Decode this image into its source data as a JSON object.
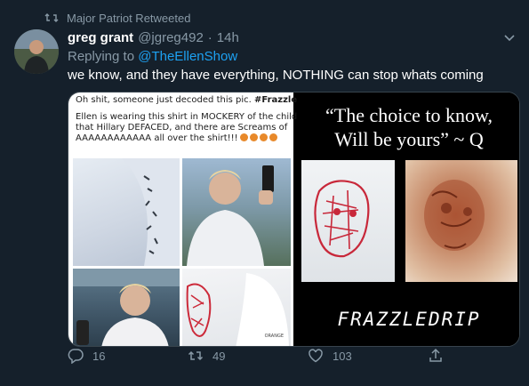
{
  "retweet_header": {
    "icon": "retweet-icon",
    "text": "Major Patriot Retweeted"
  },
  "tweet": {
    "author_name": "greg grant",
    "handle": "@jgreg492",
    "separator": "·",
    "time": "14h",
    "reply_prefix": "Replying to",
    "reply_to": "@TheEllenShow",
    "text": "we know, and they have everything, NOTHING can stop whats coming"
  },
  "media": {
    "left_panel": {
      "caption_prefix": "Oh shit, someone just decoded this pic.",
      "caption_tag": "#Frazzledrip",
      "body_lines": [
        "Ellen is wearing this shirt in MOCKERY of the child",
        "that Hillary DEFACED, and there are Screams of",
        "AAAAAAAAAAAA all over the shirt!!!"
      ],
      "shirt_text": "ORANGE"
    },
    "right_panel": {
      "quote_line1": "“The choice to know,",
      "quote_line2": "Will be yours” ~ Q",
      "bottom_text": "FRAZZLEDRIP"
    }
  },
  "actions": {
    "reply_count": "16",
    "retweet_count": "49",
    "like_count": "103"
  },
  "colors": {
    "background": "#15202b",
    "secondary_text": "#8899a6",
    "link": "#1da1f2",
    "border": "#38444d"
  }
}
